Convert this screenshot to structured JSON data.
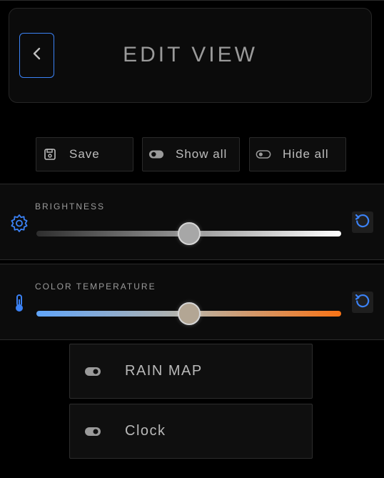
{
  "header": {
    "title": "EDIT VIEW",
    "back_icon": "chevron-left-icon"
  },
  "toolbar": {
    "save_label": "Save",
    "show_all_label": "Show all",
    "hide_all_label": "Hide all"
  },
  "brightness": {
    "label": "BRIGHTNESS",
    "value_fraction": 0.5,
    "icon": "gear-icon"
  },
  "color_temperature": {
    "label": "COLOR TEMPERATURE",
    "value_fraction": 0.5,
    "icon": "thermometer-icon"
  },
  "widgets": [
    {
      "label": "RAIN MAP",
      "toggle_state": "on"
    },
    {
      "label": "Clock",
      "toggle_state": "on"
    }
  ],
  "colors": {
    "accent": "#3b82f6",
    "background": "#000000",
    "temp_cool": "#60a5fa",
    "temp_warm": "#f97316"
  }
}
